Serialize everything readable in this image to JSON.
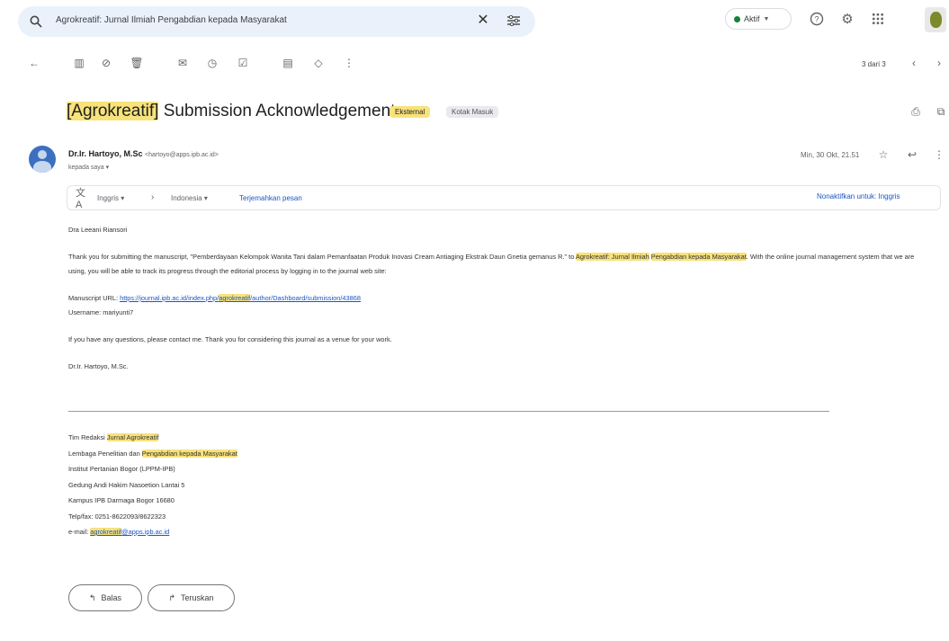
{
  "search": {
    "value": "Agrokreatif: Jurnal Ilmiah Pengabdian kepada Masyarakat"
  },
  "status": {
    "label": "Aktif"
  },
  "pager": {
    "text": "3 dari 3"
  },
  "email": {
    "subject_tag": "[Agrokreatif]",
    "subject_rest": " Submission Acknowledgement",
    "label_1": "Eksternal",
    "label_2": "Kotak Masuk",
    "sender_name": "Dr.Ir. Hartoyo, M.Sc",
    "sender_email": "<hartoyo@apps.ipb.ac.id>",
    "to_line": "kepada saya",
    "date": "Min, 30 Okt, 21.51"
  },
  "translate": {
    "from": "Inggris",
    "to": "Indonesia",
    "action": "Terjemahkan pesan",
    "off": "Nonaktifkan untuk: Inggris"
  },
  "body": {
    "greeting": "Dra Leeani Riansori",
    "p1_a": "Thank you for submitting the manuscript, \"Pemberdayaan Kelompok Wanita Tani dalam Pemanfaatan Produk Inovasi Cream Antiaging Ekstrak Daun Gnetia gemanus R.\" to ",
    "p1_h1": "Agrokreatif: Jurnal Ilmiah",
    "p1_h2": "Pengabdian kepada Masyarakat",
    "p1_b": ". With the online journal management system that we are using, you will be able to track its progress through the editorial process by logging in to the journal web site:",
    "url_label": "Manuscript URL: ",
    "url_a": "https://journal.ipb.ac.id/index.php/",
    "url_h": "agrokreatif",
    "url_b": "/author/Dashboard/submission/43868",
    "username": "Username: mariyunti7",
    "p2": "If you have any questions, please contact me. Thank you for considering this journal as a venue for your work.",
    "sign": "Dr.Ir. Hartoyo, M.Sc."
  },
  "signature": {
    "l1_a": "Tim Redaksi ",
    "l1_h": "Jurnal Agrokreatif",
    "l2_a": "Lembaga Penelitian dan ",
    "l2_h": "Pengabdian kepada Masyarakat",
    "l3": "Institut Pertanian Bogor (LPPM-IPB)",
    "l4": "Gedung Andi Hakim Nasoetion Lantai 5",
    "l5": "Kampus IPB Darmaga Bogor 16680",
    "l6": "Telp/fax: 0251-8622093/8622323",
    "l7_a": "e-mail: ",
    "l7_h": "agrokreatif",
    "l7_b": "@apps.ipb.ac.id"
  },
  "actions": {
    "reply": "Balas",
    "forward": "Teruskan"
  },
  "colors": {
    "highlight": "#f7e27b",
    "link": "#1a56c4",
    "status_dot": "#188038"
  }
}
